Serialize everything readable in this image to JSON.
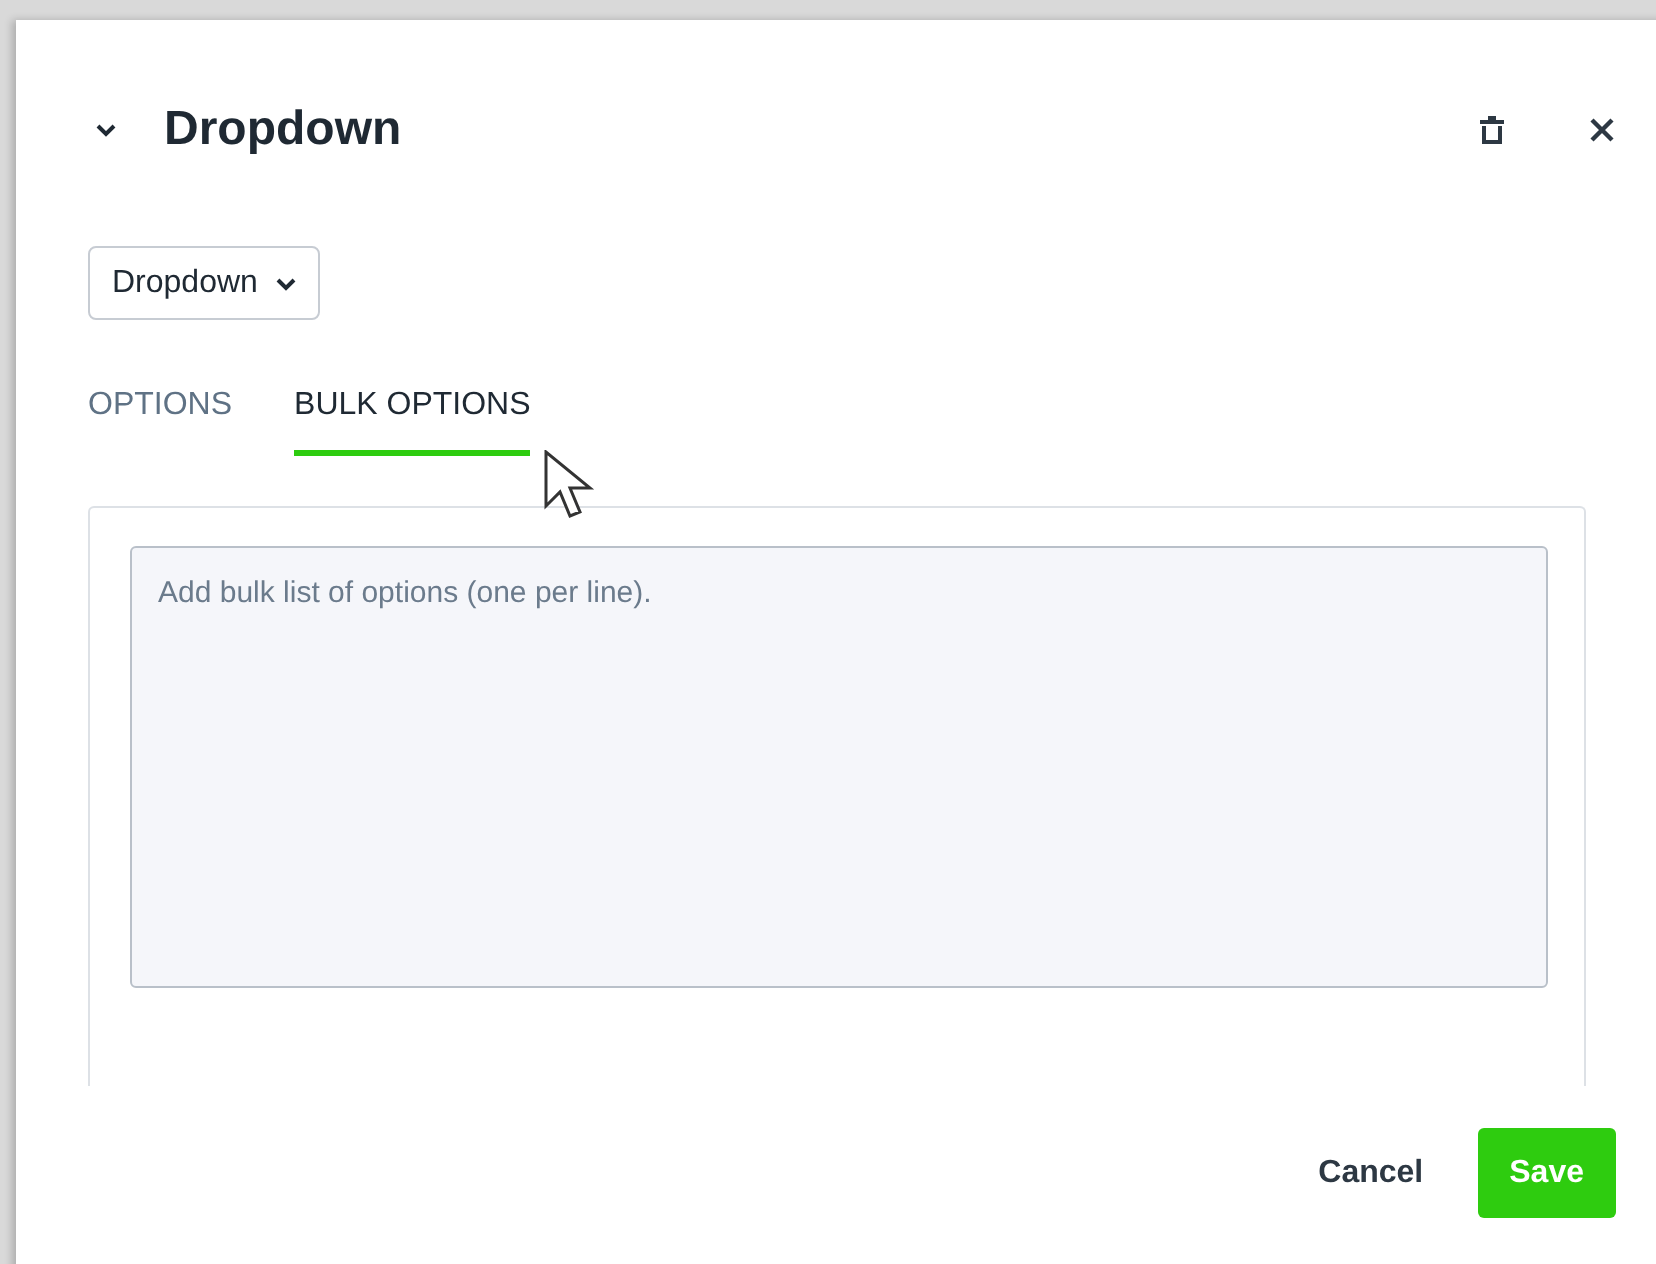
{
  "header": {
    "title": "Dropdown",
    "expanded": true
  },
  "type_select": {
    "value": "Dropdown"
  },
  "tabs": [
    {
      "label": "OPTIONS",
      "selected": false
    },
    {
      "label": "BULK OPTIONS",
      "selected": true
    }
  ],
  "bulk_options": {
    "placeholder": "Add bulk list of options (one per line)."
  },
  "footer": {
    "cancel": "Cancel",
    "save": "Save"
  }
}
